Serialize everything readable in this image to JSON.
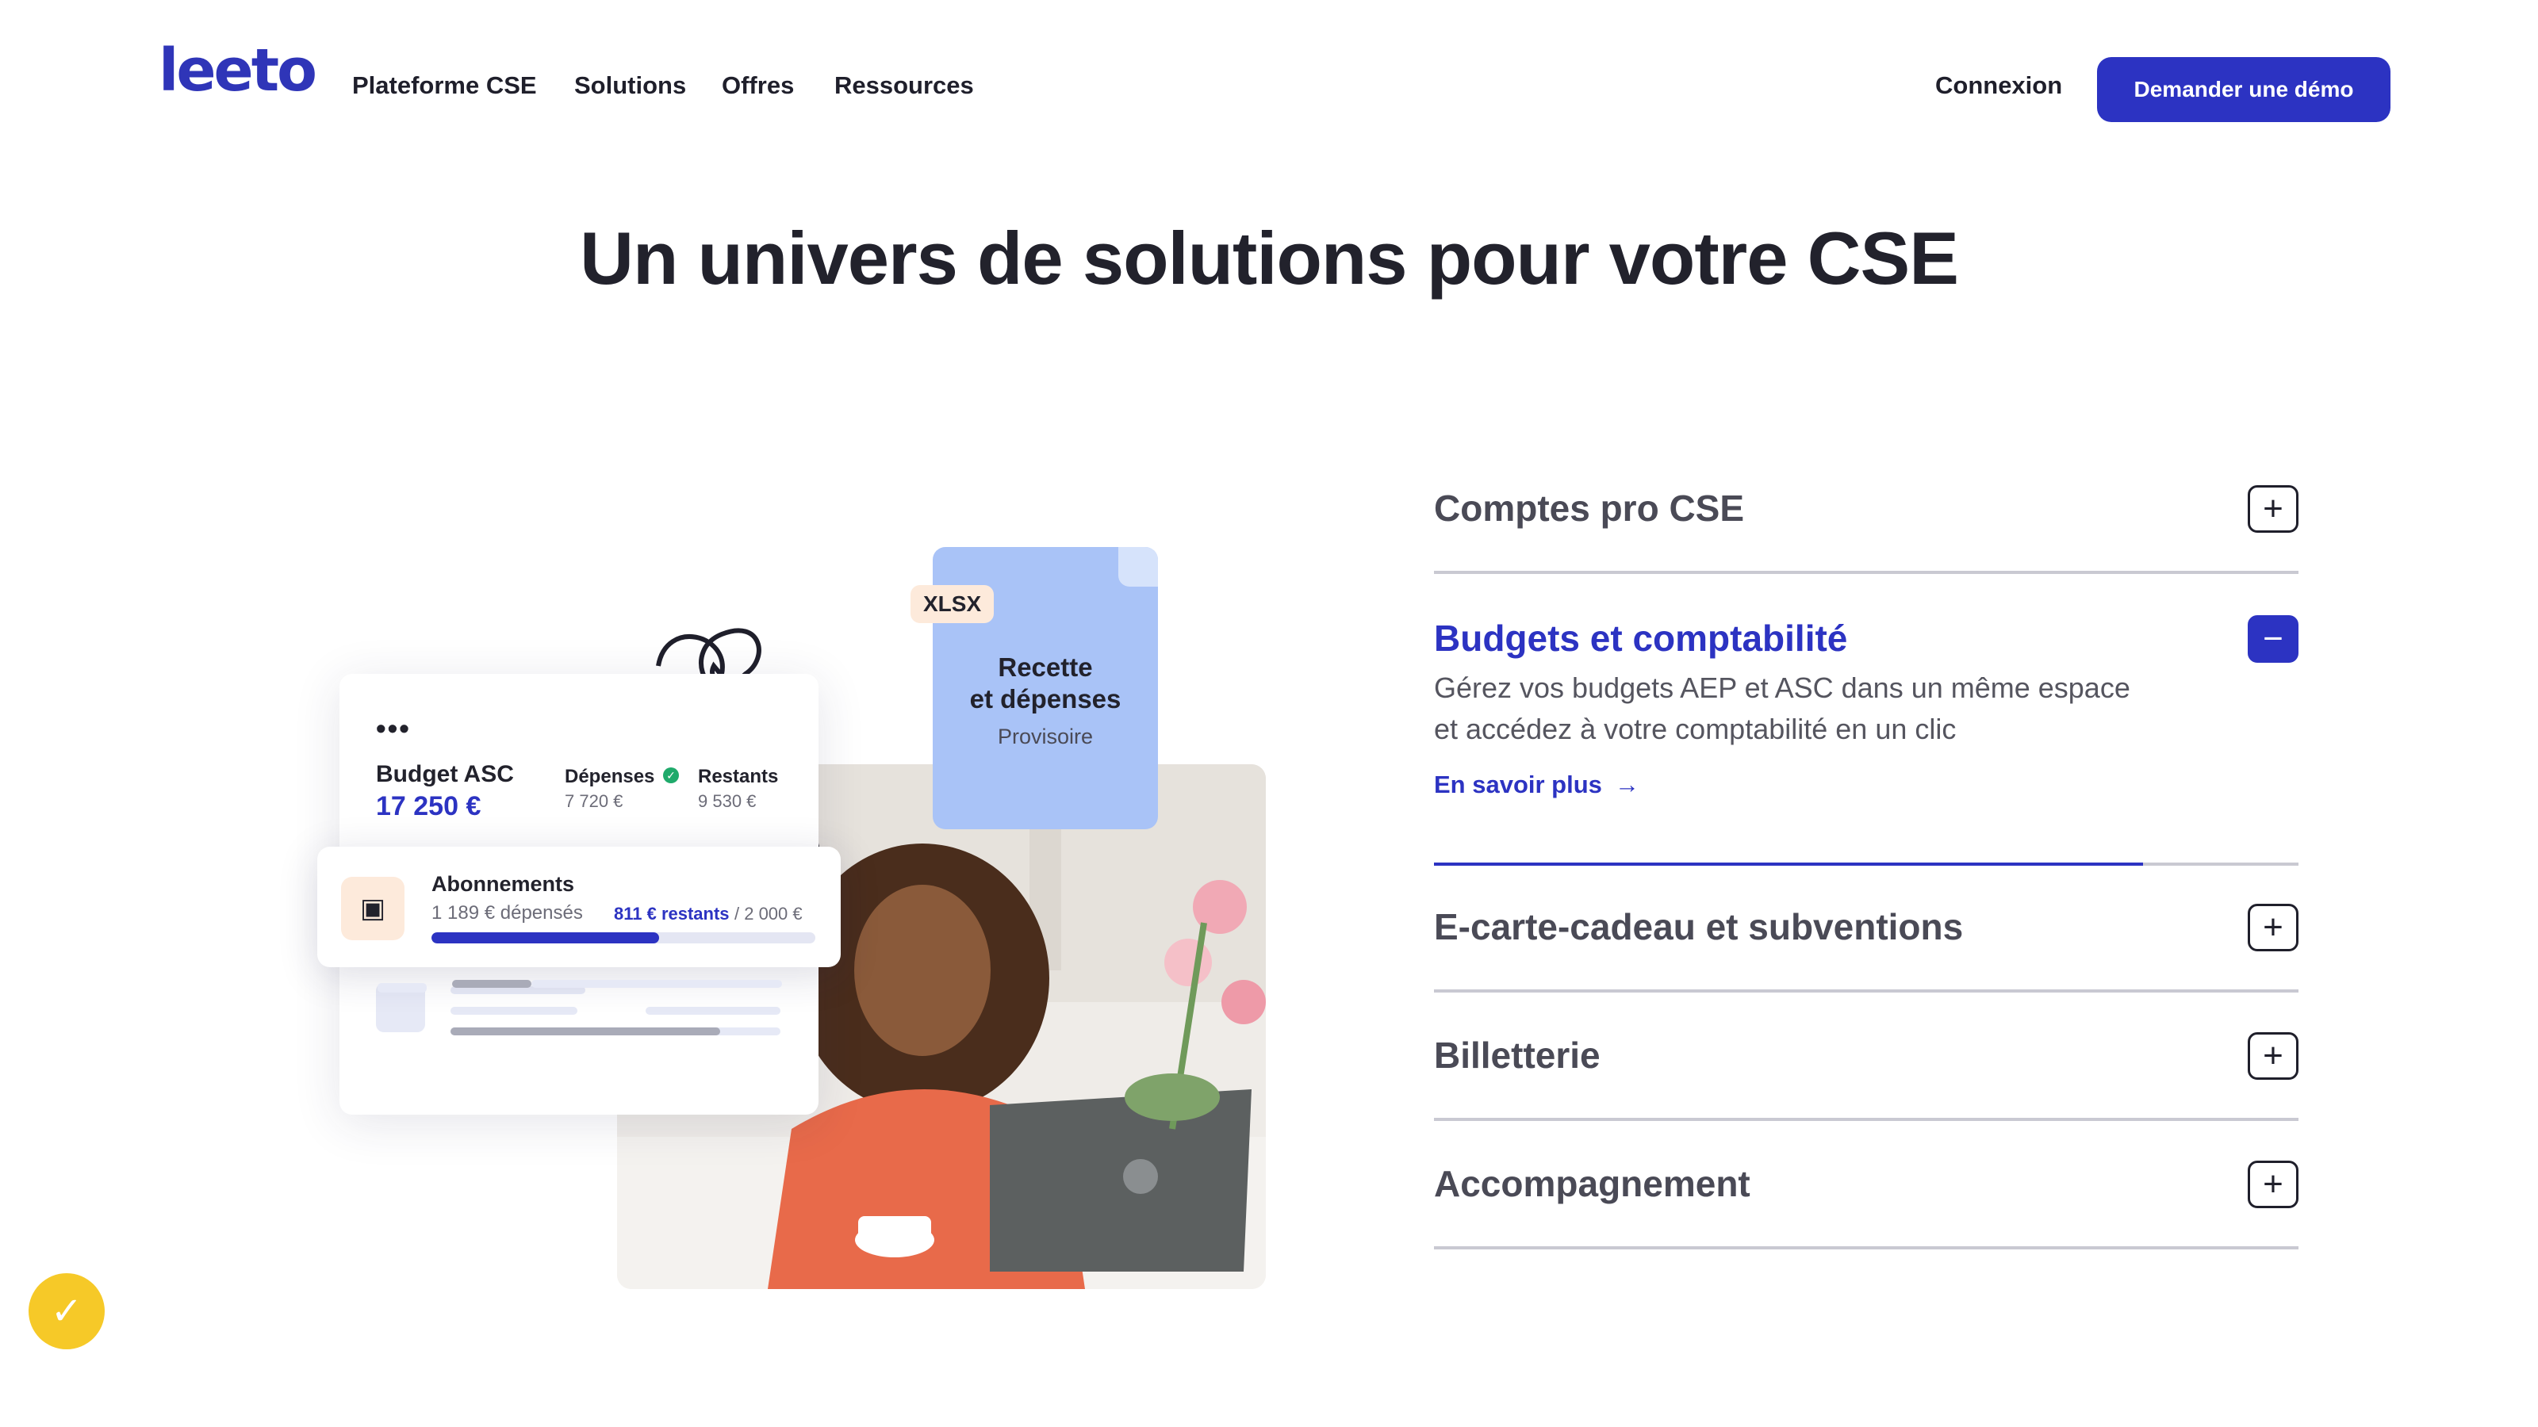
{
  "nav": {
    "logo": "leeto",
    "links": [
      "Plateforme CSE",
      "Solutions",
      "Offres",
      "Ressources"
    ],
    "login": "Connexion",
    "demo": "Demander une démo"
  },
  "headline": "Un univers de solutions pour votre CSE",
  "illustration": {
    "budget_card": {
      "dots": "•••",
      "budget_label": "Budget ASC",
      "budget_value": "17 250 €",
      "depenses_label": "Dépenses",
      "depenses_value": "7 720 €",
      "restants_label": "Restants",
      "restants_value": "9 530 €"
    },
    "abonnements": {
      "title": "Abonnements",
      "spent": "1 189 € dépensés",
      "remaining": "811 € restants",
      "total": "/ 2 000 €",
      "progress": 0.594
    },
    "document": {
      "badge": "XLSX",
      "title_line1": "Recette",
      "title_line2": "et dépenses",
      "subtitle": "Provisoire"
    }
  },
  "accordion": {
    "items": [
      {
        "title": "Comptes pro CSE",
        "icon": "+"
      },
      {
        "title": "Budgets et comptabilité",
        "icon": "−",
        "expanded": true,
        "description": "Gérez vos budgets AEP et ASC dans un même espace et accédez à votre comptabilité en un clic",
        "link": "En savoir plus",
        "link_icon": "→",
        "progress": 0.82
      },
      {
        "title": "E-carte-cadeau et subventions",
        "icon": "+"
      },
      {
        "title": "Billetterie",
        "icon": "+"
      },
      {
        "title": "Accompagnement",
        "icon": "+"
      }
    ]
  },
  "colors": {
    "brand": "#2c33c2",
    "doc": "#a9c3f7",
    "cookie": "#f6c928"
  }
}
